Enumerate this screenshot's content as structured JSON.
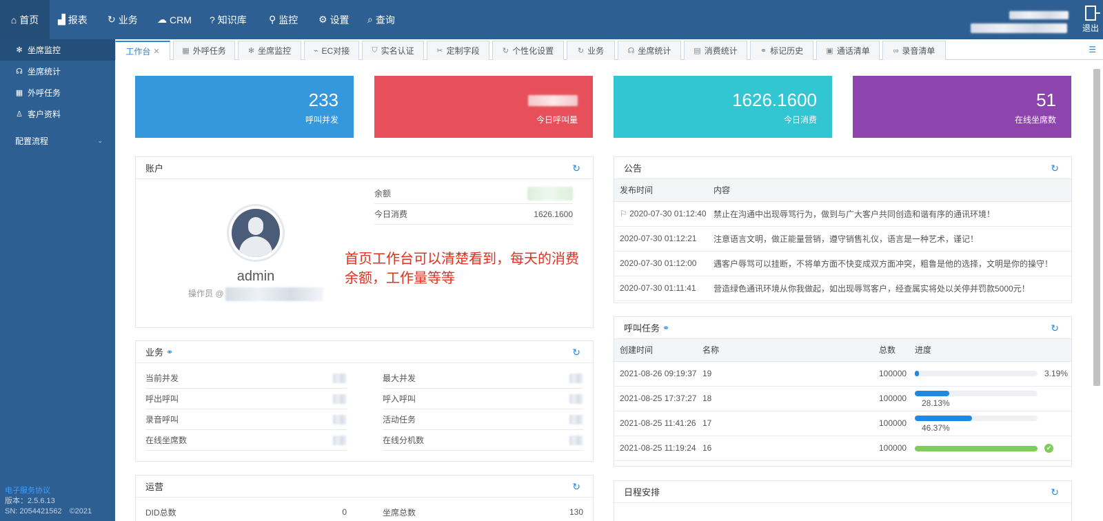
{
  "nav": {
    "items": [
      {
        "label": "首页",
        "icon": "home-icon",
        "glyph": "⌂"
      },
      {
        "label": "报表",
        "icon": "chart-icon",
        "glyph": "▟"
      },
      {
        "label": "业务",
        "icon": "refresh-icon",
        "glyph": "↻"
      },
      {
        "label": "CRM",
        "icon": "cloud-icon",
        "glyph": "☁"
      },
      {
        "label": "知识库",
        "icon": "question-icon",
        "glyph": "?"
      },
      {
        "label": "监控",
        "icon": "monitor-icon",
        "glyph": "⚲"
      },
      {
        "label": "设置",
        "icon": "gear-icon",
        "glyph": "⚙"
      },
      {
        "label": "查询",
        "icon": "search-icon",
        "glyph": "⌕"
      }
    ],
    "logout_label": "退出"
  },
  "sidebar": {
    "items": [
      {
        "label": "坐席监控",
        "glyph": "✻"
      },
      {
        "label": "坐席统计",
        "glyph": "☊"
      },
      {
        "label": "外呼任务",
        "glyph": "▦"
      },
      {
        "label": "客户资料",
        "glyph": "♙"
      }
    ],
    "group_label": "配置流程",
    "footer": {
      "link": "电子服务协议",
      "version": "版本：2.5.6.13",
      "sn": "SN: 2054421562　©2021"
    }
  },
  "tabs": [
    {
      "label": "工作台",
      "icon": ""
    },
    {
      "label": "外呼任务",
      "icon": "▦"
    },
    {
      "label": "坐席监控",
      "icon": "✻"
    },
    {
      "label": "EC对接",
      "icon": "⌁"
    },
    {
      "label": "实名认证",
      "icon": "⛉"
    },
    {
      "label": "定制字段",
      "icon": "✂"
    },
    {
      "label": "个性化设置",
      "icon": "↻"
    },
    {
      "label": "业务",
      "icon": "↻"
    },
    {
      "label": "坐席统计",
      "icon": "☊"
    },
    {
      "label": "消费统计",
      "icon": "▤"
    },
    {
      "label": "标记历史",
      "icon": "⚭"
    },
    {
      "label": "通话清单",
      "icon": "▣"
    },
    {
      "label": "录音清单",
      "icon": "∞"
    }
  ],
  "stats": [
    {
      "value": "233",
      "label": "呼叫并发",
      "color": "#3598dc"
    },
    {
      "value": "",
      "label": "今日呼叫量",
      "color": "#e7505a"
    },
    {
      "value": "1626.1600",
      "label": "今日消费",
      "color": "#32c5d2"
    },
    {
      "value": "51",
      "label": "在线坐席数",
      "color": "#8e44ad"
    }
  ],
  "account": {
    "title": "账户",
    "username": "admin",
    "role": "操作员 @",
    "balance_label": "余额",
    "today_cost_label": "今日消费",
    "today_cost_value": "1626.1600"
  },
  "annotation": {
    "line1": "首页工作台可以清楚看到，每天的消费",
    "line2": "余额，工作量等等"
  },
  "business": {
    "title": "业务",
    "rows": [
      [
        "当前并发",
        "最大并发"
      ],
      [
        "呼出呼叫",
        "呼入呼叫"
      ],
      [
        "录音呼叫",
        "活动任务"
      ],
      [
        "在线坐席数",
        "在线分机数"
      ]
    ]
  },
  "ops": {
    "title": "运营",
    "did_label": "DID总数",
    "did_value": "0",
    "seat_label": "坐席总数",
    "seat_value": "130"
  },
  "notice": {
    "title": "公告",
    "headers": [
      "发布时间",
      "内容"
    ],
    "rows": [
      {
        "time": "2020-07-30 01:12:40",
        "content": "禁止在沟通中出现辱骂行为，做到与广大客户共同创造和谐有序的通讯环境！"
      },
      {
        "time": "2020-07-30 01:12:21",
        "content": "注意语言文明，做正能量营销，遵守销售礼仪，语言是一种艺术，谨记！"
      },
      {
        "time": "2020-07-30 01:12:00",
        "content": "遇客户辱骂可以挂断，不将单方面不快变成双方面冲突，粗鲁是他的选择，文明是你的操守！"
      },
      {
        "time": "2020-07-30 01:11:41",
        "content": "营造绿色通讯环境从你我做起，如出现辱骂客户，经查属实将处以关停并罚款5000元！"
      }
    ]
  },
  "tasks": {
    "title": "呼叫任务",
    "headers": [
      "创建时间",
      "名称",
      "总数",
      "进度"
    ],
    "rows": [
      {
        "time": "2021-08-26 09:19:37",
        "name": "19",
        "total": "100000",
        "progress": 0.0319,
        "pct": "3.19%",
        "done": false
      },
      {
        "time": "2021-08-25 17:37:27",
        "name": "18",
        "total": "100000",
        "progress": 0.2813,
        "pct": "28.13%",
        "done": false
      },
      {
        "time": "2021-08-25 11:41:26",
        "name": "17",
        "total": "100000",
        "progress": 0.4637,
        "pct": "46.37%",
        "done": false
      },
      {
        "time": "2021-08-25 11:19:24",
        "name": "16",
        "total": "100000",
        "progress": 1.0,
        "pct": "",
        "done": true
      }
    ]
  },
  "schedule": {
    "title": "日程安排"
  }
}
